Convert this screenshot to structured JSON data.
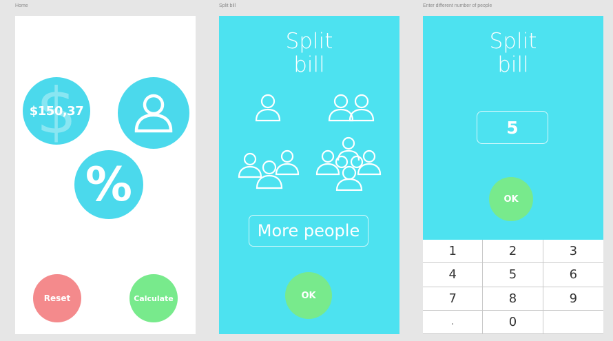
{
  "artboards": {
    "home": {
      "title": "Home",
      "amount": "$150,37",
      "reset_label": "Reset",
      "calculate_label": "Calculate"
    },
    "split_bill": {
      "title": "Split bill",
      "heading_line1": "Split",
      "heading_line2": "bill",
      "more_people_label": "More people",
      "ok_label": "OK"
    },
    "enter_people": {
      "title": "Enter different number of people",
      "heading_line1": "Split",
      "heading_line2": "bill",
      "count_value": "5",
      "ok_label": "OK",
      "keypad": [
        "1",
        "2",
        "3",
        "4",
        "5",
        "6",
        "7",
        "8",
        "9",
        ".",
        "0",
        ""
      ]
    }
  },
  "colors": {
    "cyan": "#4de2f0",
    "cyan_circle": "#4bd9ec",
    "green": "#78ea8c",
    "red": "#f48a8c"
  },
  "icons": [
    "dollar-icon",
    "person-icon",
    "percent-icon",
    "people-1-icon",
    "people-2-icon",
    "people-3-icon",
    "people-4-icon"
  ]
}
